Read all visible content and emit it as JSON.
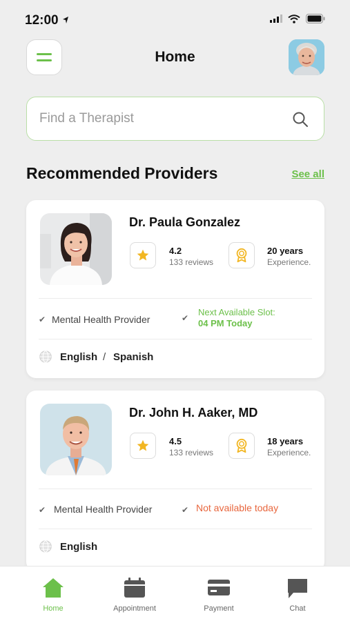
{
  "status": {
    "time": "12:00"
  },
  "header": {
    "title": "Home"
  },
  "search": {
    "placeholder": "Find a Therapist"
  },
  "recommended": {
    "title": "Recommended Providers",
    "see_all": "See all"
  },
  "providers": [
    {
      "name": "Dr. Paula Gonzalez",
      "rating": "4.2",
      "reviews": "133 reviews",
      "experience": "20 years",
      "experience_label": "Experience.",
      "specialty": "Mental Health Provider",
      "slot_label": "Next Available Slot:",
      "slot_value": "04 PM Today",
      "languages": [
        "English",
        "Spanish"
      ],
      "language_separator": "/"
    },
    {
      "name": "Dr. John H. Aaker, MD",
      "rating": "4.5",
      "reviews": "133 reviews",
      "experience": "18 years",
      "experience_label": "Experience.",
      "specialty": "Mental Health Provider",
      "availability": "Not available today",
      "languages": [
        "English"
      ]
    }
  ],
  "tabs": [
    {
      "label": "Home",
      "icon": "home-icon",
      "active": true
    },
    {
      "label": "Appointment",
      "icon": "calendar-icon",
      "active": false
    },
    {
      "label": "Payment",
      "icon": "credit-card-icon",
      "active": false
    },
    {
      "label": "Chat",
      "icon": "chat-icon",
      "active": false
    }
  ],
  "colors": {
    "accent": "#6cc04a",
    "warning": "#e8663d",
    "star": "#f2b622"
  }
}
